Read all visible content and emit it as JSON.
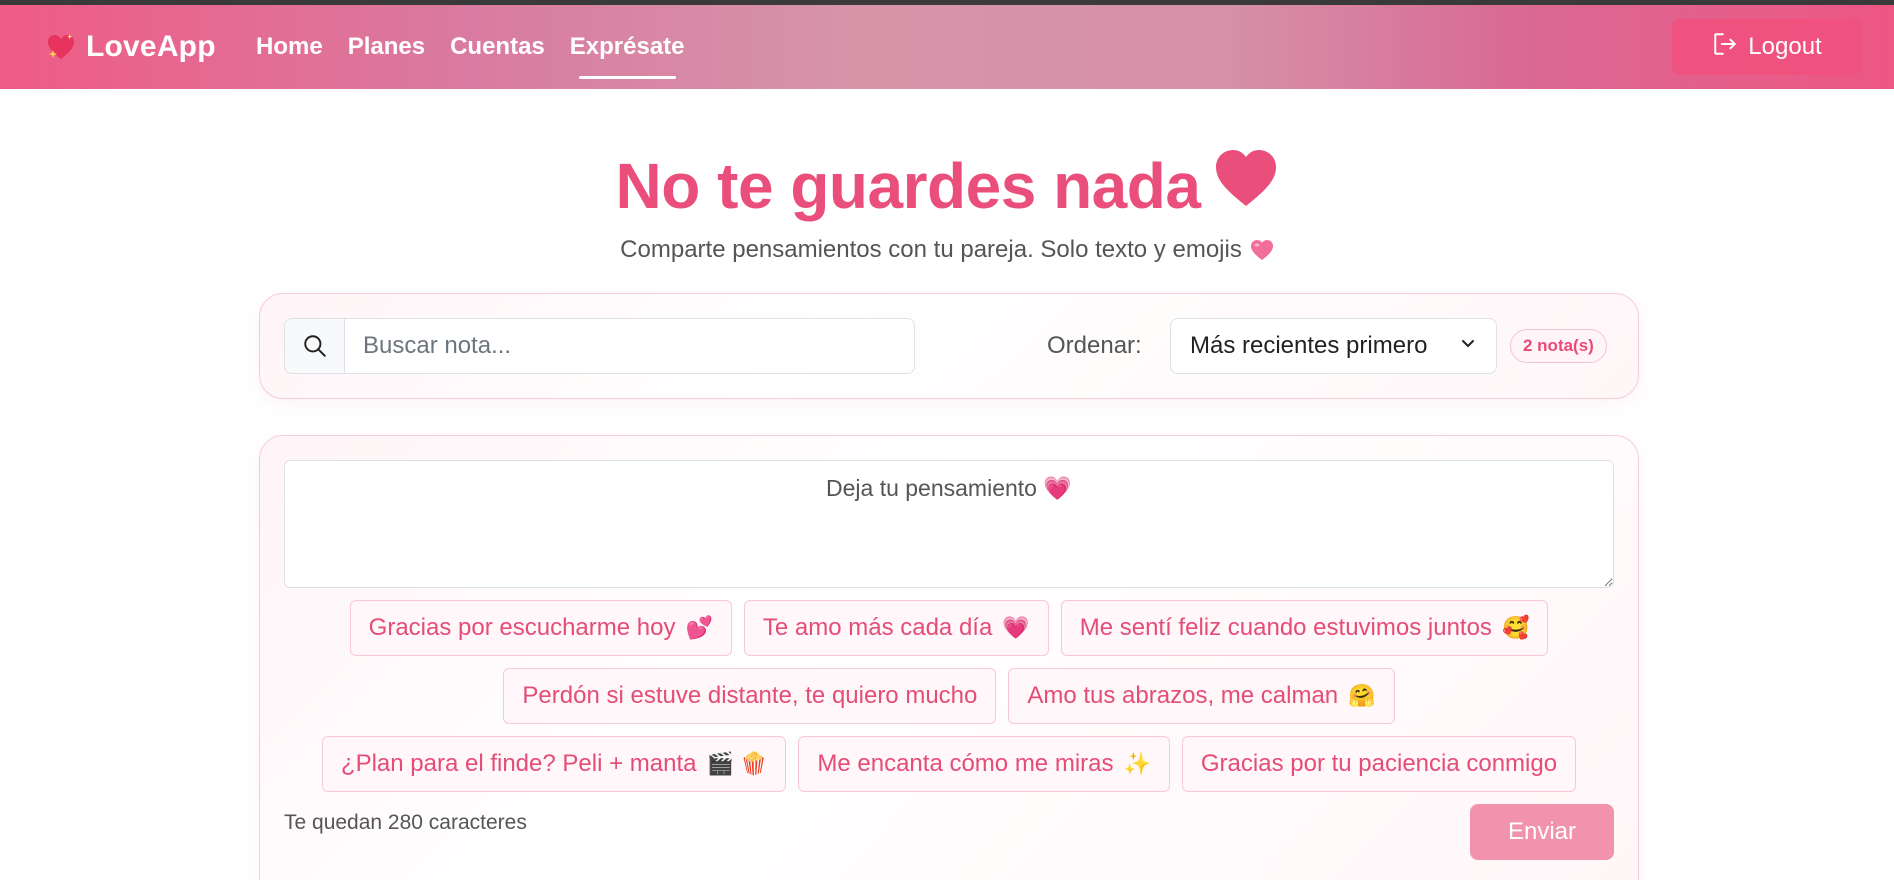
{
  "navbar": {
    "brand": "LoveApp",
    "links": [
      "Home",
      "Planes",
      "Cuentas",
      "Exprésate"
    ],
    "active_link": "Exprésate",
    "logout_label": "Logout",
    "colors": {
      "gradient_start": "#ef5b86",
      "gradient_end": "#ee5684"
    }
  },
  "hero": {
    "title": "No te guardes nada",
    "subtitle": "Comparte pensamientos con tu pareja. Solo texto y emojis",
    "accent_color": "#ea4f7c"
  },
  "search": {
    "placeholder": "Buscar nota...",
    "value": "",
    "sort_label": "Ordenar:",
    "sort_selected": "Más recientes primero",
    "count_badge": "2 nota(s)"
  },
  "compose": {
    "placeholder": "Deja tu pensamiento 💗",
    "suggestions": [
      {
        "text": "Gracias por escucharme hoy",
        "emoji": "💕"
      },
      {
        "text": "Te amo más cada día",
        "emoji": "💗"
      },
      {
        "text": "Me sentí feliz cuando estuvimos juntos",
        "emoji": "🥰"
      },
      {
        "text": "Perdón si estuve distante, te quiero mucho",
        "emoji": ""
      },
      {
        "text": "Amo tus abrazos, me calman",
        "emoji": "🤗"
      },
      {
        "text": "¿Plan para el finde? Peli + manta",
        "emoji": "🎬 🍿"
      },
      {
        "text": "Me encanta cómo me miras",
        "emoji": "✨"
      },
      {
        "text": "Gracias por tu paciencia conmigo",
        "emoji": ""
      }
    ],
    "char_count": "Te quedan 280 caracteres",
    "send_label": "Enviar",
    "send_color": "#f193ac"
  },
  "icons": [
    "sparkle-heart-icon",
    "logout-icon",
    "heart-icon",
    "search-icon",
    "chevron-down-icon"
  ]
}
